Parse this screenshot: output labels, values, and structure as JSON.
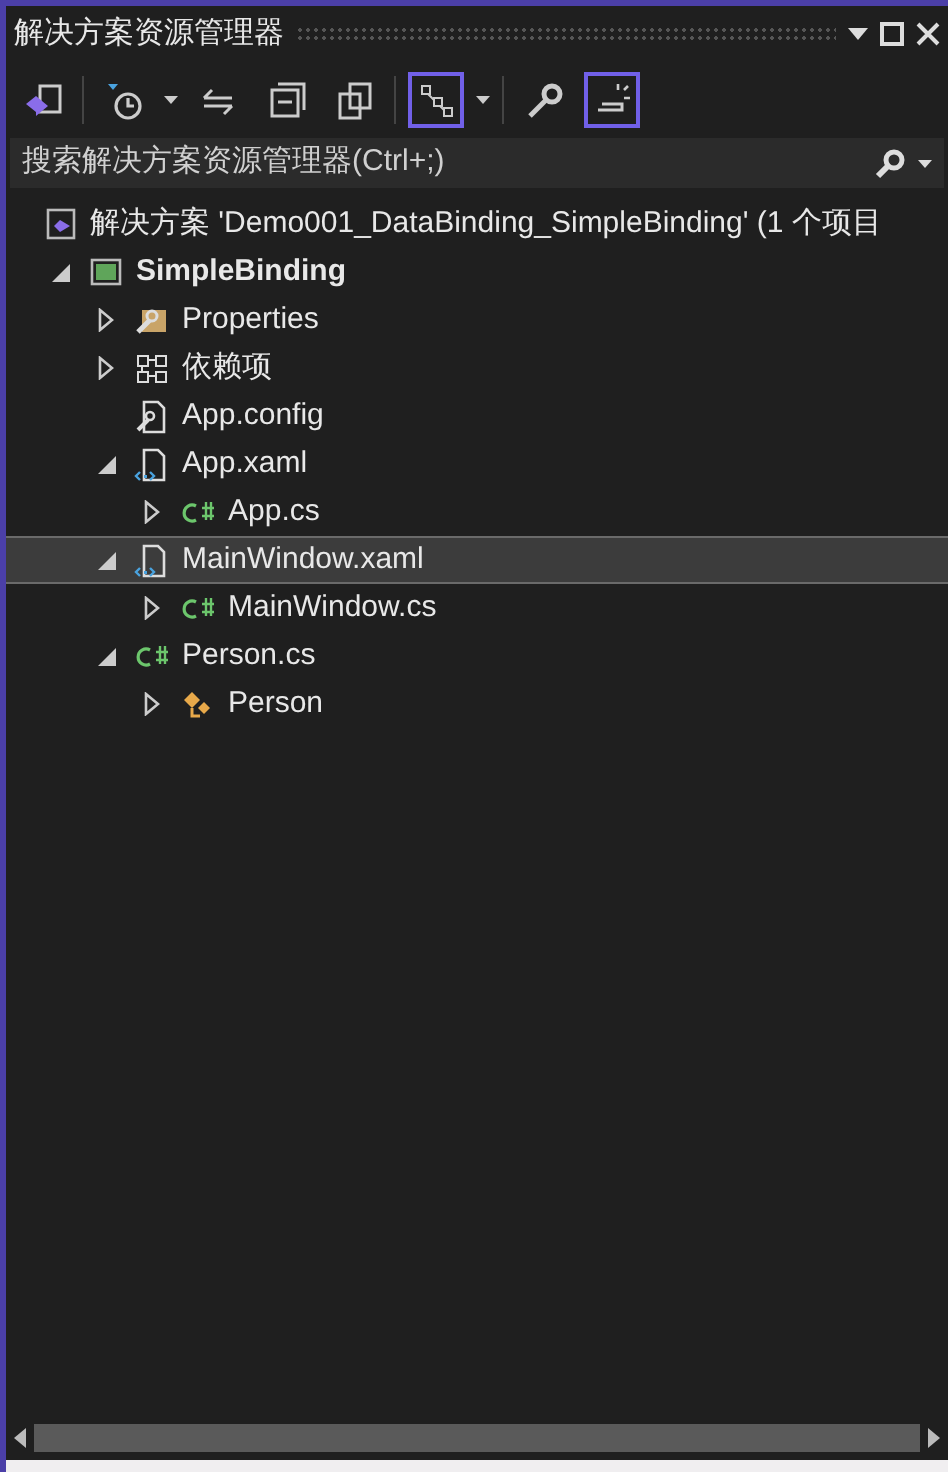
{
  "window": {
    "title": "解决方案资源管理器"
  },
  "search": {
    "placeholder": "搜索解决方案资源管理器(Ctrl+;)"
  },
  "toolbar": [
    {
      "kind": "vs",
      "selected": false
    },
    {
      "kind": "sep"
    },
    {
      "kind": "history",
      "selected": false
    },
    {
      "kind": "dropdown"
    },
    {
      "kind": "sync",
      "selected": false
    },
    {
      "kind": "collapse",
      "selected": false
    },
    {
      "kind": "copies",
      "selected": false
    },
    {
      "kind": "sep"
    },
    {
      "kind": "view",
      "selected": true
    },
    {
      "kind": "dropdown"
    },
    {
      "kind": "sep"
    },
    {
      "kind": "wrench",
      "selected": false
    },
    {
      "kind": "preview",
      "selected": true
    }
  ],
  "tree": [
    {
      "kind": "solution",
      "label": "解决方案 'Demo001_DataBinding_SimpleBinding' (1 个项目",
      "selected": false,
      "children": [
        {
          "kind": "project",
          "label": "SimpleBinding",
          "expanded": true,
          "selected": false,
          "children": [
            {
              "kind": "properties",
              "label": "Properties",
              "expanded": false,
              "selected": false
            },
            {
              "kind": "dependencies",
              "label": "依赖项",
              "expanded": false,
              "selected": false
            },
            {
              "kind": "config",
              "label": "App.config",
              "selected": false
            },
            {
              "kind": "xaml",
              "label": "App.xaml",
              "expanded": true,
              "selected": false,
              "children": [
                {
                  "kind": "cs",
                  "label": "App.cs",
                  "expanded": false,
                  "selected": false
                }
              ]
            },
            {
              "kind": "xaml",
              "label": "MainWindow.xaml",
              "expanded": true,
              "selected": true,
              "children": [
                {
                  "kind": "cs",
                  "label": "MainWindow.cs",
                  "expanded": false,
                  "selected": false
                }
              ]
            },
            {
              "kind": "cs",
              "label": "Person.cs",
              "expanded": true,
              "selected": false,
              "children": [
                {
                  "kind": "class",
                  "label": "Person",
                  "expanded": false,
                  "selected": false
                }
              ]
            }
          ]
        }
      ]
    }
  ]
}
